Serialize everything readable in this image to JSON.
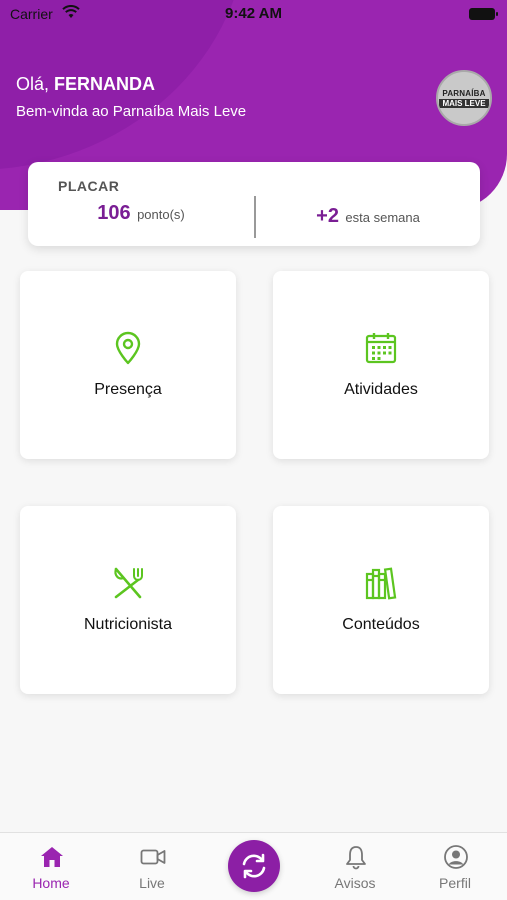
{
  "status_bar": {
    "carrier": "Carrier",
    "time": "9:42 AM"
  },
  "header": {
    "greeting_prefix": "Olá,",
    "user_name": "FERNANDA",
    "welcome": "Bem-vinda ao Parnaíba Mais Leve",
    "avatar_logo_top": "PARNAÍBA",
    "avatar_logo_bottom": "MAIS LEVE"
  },
  "score": {
    "title": "PLACAR",
    "points_value": "106",
    "points_unit": "ponto(s)",
    "week_value": "+2",
    "week_unit": "esta semana"
  },
  "tiles": [
    {
      "label": "Presença",
      "icon": "location-pin-icon"
    },
    {
      "label": "Atividades",
      "icon": "calendar-icon"
    },
    {
      "label": "Nutricionista",
      "icon": "fork-knife-icon"
    },
    {
      "label": "Conteúdos",
      "icon": "books-icon"
    }
  ],
  "tabbar": {
    "items": [
      {
        "label": "Home",
        "icon": "home-icon",
        "active": true
      },
      {
        "label": "Live",
        "icon": "video-camera-icon"
      },
      {
        "label": "Avisos",
        "icon": "bell-icon"
      },
      {
        "label": "Perfil",
        "icon": "user-circle-icon"
      }
    ],
    "center_icon": "sync-icon"
  },
  "colors": {
    "brand_purple": "#9a25b0",
    "dark_purple": "#7a1e94",
    "icon_green": "#5cc520"
  }
}
